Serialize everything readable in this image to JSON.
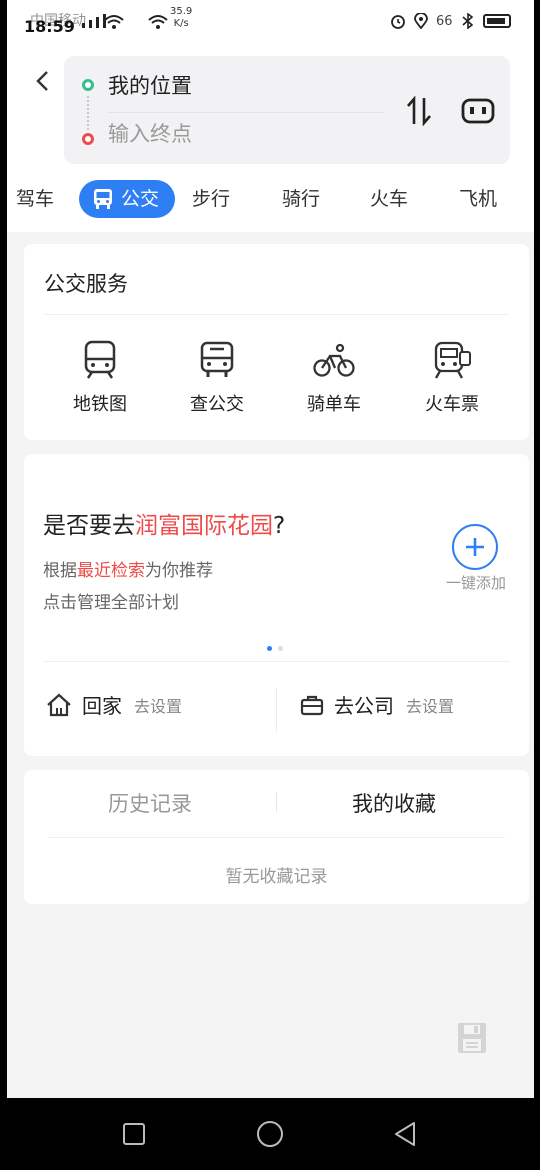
{
  "status": {
    "carrier": "中国移动",
    "time": "18:59",
    "speed_value": "35.9",
    "speed_unit": "K/s",
    "battery": "66"
  },
  "route": {
    "from": "我的位置",
    "to_placeholder": "输入终点"
  },
  "tabs": [
    {
      "label": "驾车"
    },
    {
      "label": "公交"
    },
    {
      "label": "步行"
    },
    {
      "label": "骑行"
    },
    {
      "label": "火车"
    },
    {
      "label": "飞机"
    }
  ],
  "services": {
    "title": "公交服务",
    "items": [
      {
        "label": "地铁图",
        "icon": "subway-icon"
      },
      {
        "label": "查公交",
        "icon": "bus-icon"
      },
      {
        "label": "骑单车",
        "icon": "bicycle-icon"
      },
      {
        "label": "火车票",
        "icon": "train-ticket-icon"
      }
    ]
  },
  "suggest": {
    "question_prefix": "是否要去",
    "place": "润富国际花园",
    "question_suffix": "?",
    "line1_prefix": "根据",
    "line1_highlight": "最近检索",
    "line1_suffix": "为你推荐",
    "line2": "点击管理全部计划",
    "add_label": "一键添加"
  },
  "shortcuts": [
    {
      "name": "回家",
      "status": "去设置",
      "icon": "home-icon"
    },
    {
      "name": "去公司",
      "status": "去设置",
      "icon": "briefcase-icon"
    }
  ],
  "records": {
    "history_tab": "历史记录",
    "favorites_tab": "我的收藏",
    "empty_text": "暂无收藏记录"
  },
  "colors": {
    "accent": "#2f7ff4",
    "highlight": "#ef4b4b",
    "start_dot": "#35c08c"
  }
}
